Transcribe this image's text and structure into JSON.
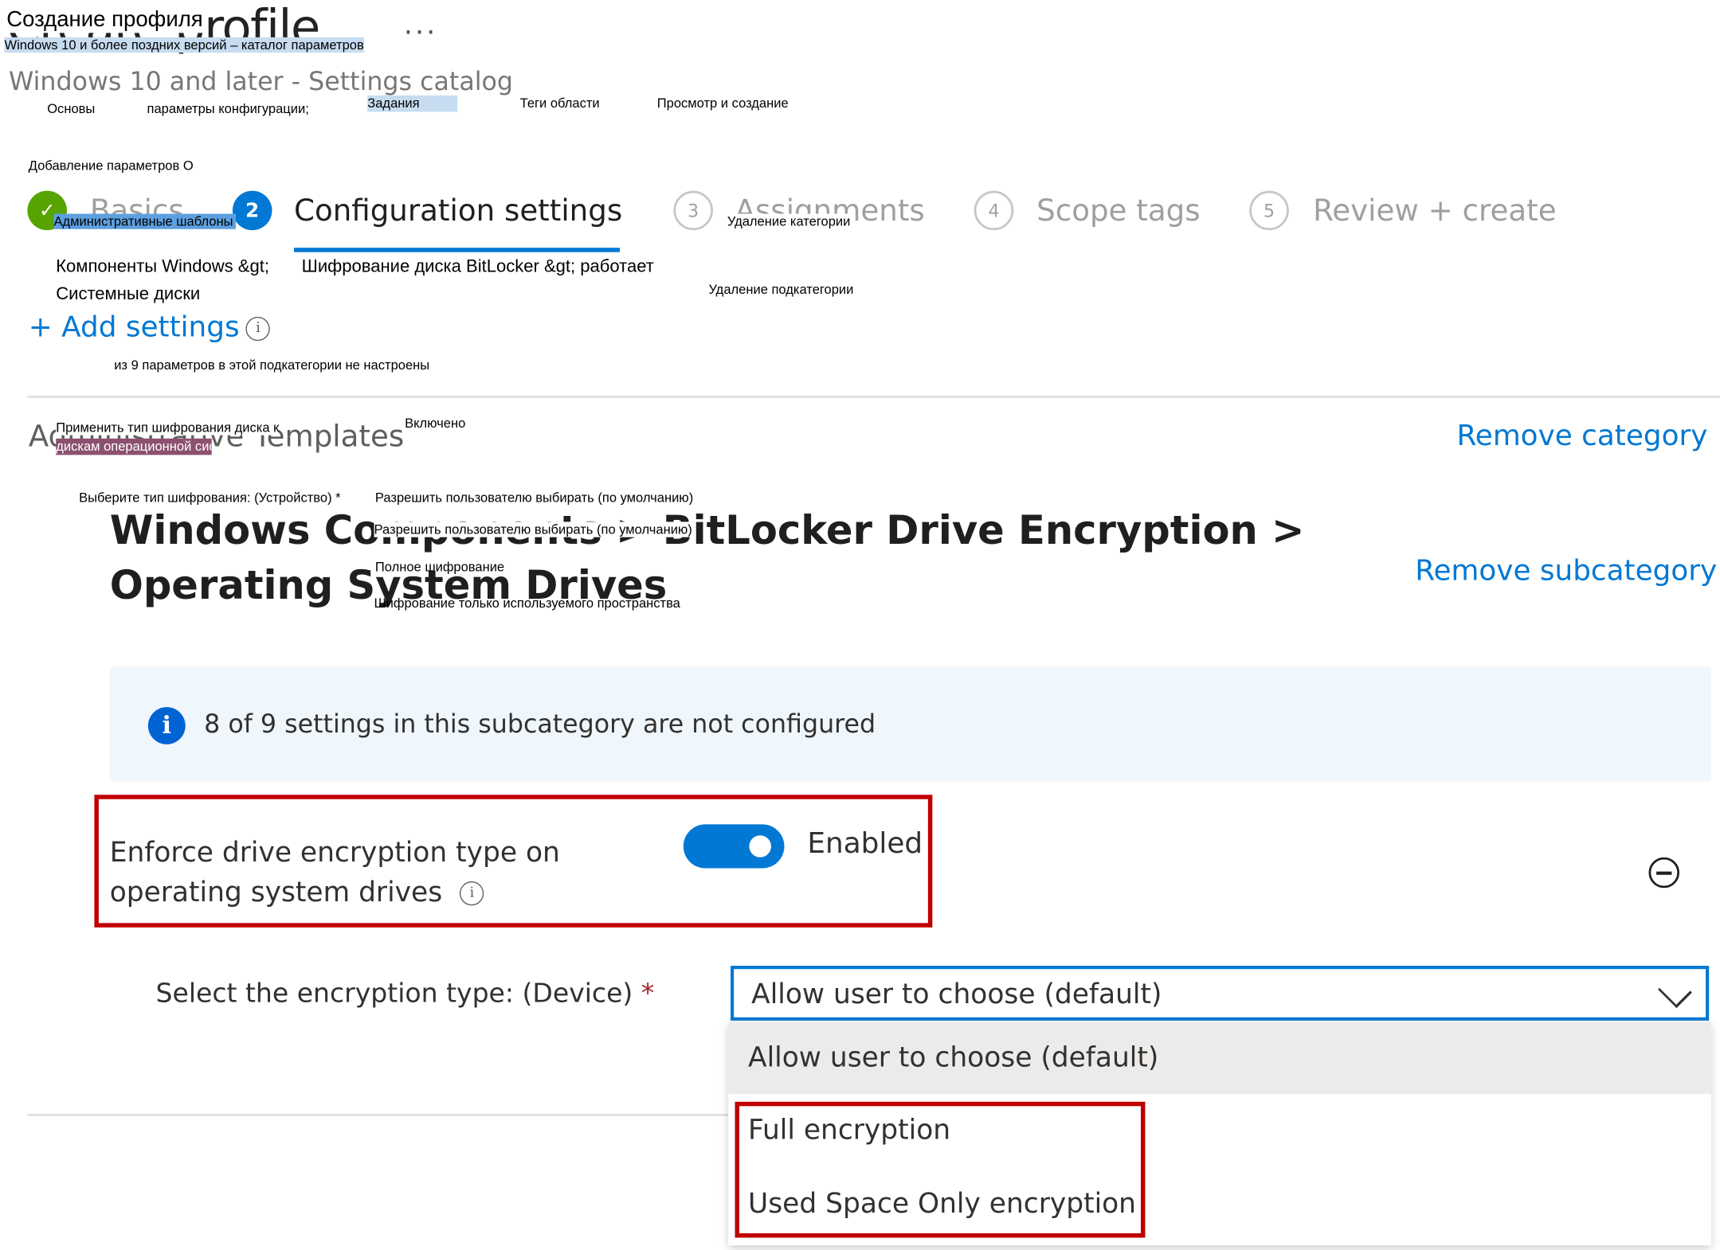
{
  "header": {
    "title": "Create profile",
    "more_icon": "ellipsis-icon",
    "more_label": "...",
    "subtitle": "Windows 10 and later - Settings catalog"
  },
  "stepper": {
    "steps": [
      {
        "number": "1",
        "label": "Basics",
        "state": "completed",
        "icon": "checkmark-icon"
      },
      {
        "number": "2",
        "label": "Configuration settings",
        "state": "active"
      },
      {
        "number": "3",
        "label": "Assignments",
        "state": "pending"
      },
      {
        "number": "4",
        "label": "Scope tags",
        "state": "pending"
      },
      {
        "number": "5",
        "label": "Review + create",
        "state": "pending"
      }
    ],
    "check_glyph": "✓"
  },
  "add_settings": {
    "label": "+ Add settings",
    "info_glyph": "i"
  },
  "category": {
    "title": "Administrative Templates",
    "remove_label": "Remove category"
  },
  "subcategory": {
    "title": "Windows Components > BitLocker Drive Encryption > Operating System Drives",
    "remove_label": "Remove subcategory"
  },
  "info_banner": {
    "icon_glyph": "i",
    "text": "8 of 9 settings in this subcategory are not configured"
  },
  "setting": {
    "name_line1": "Enforce drive encryption type on",
    "name_line2": "operating system drives",
    "info_glyph": "i",
    "toggle_state": "on",
    "toggle_label": "Enabled"
  },
  "encryption_select": {
    "label": "Select the encryption type: (Device)",
    "required_mark": "*",
    "value": "Allow user to choose (default)",
    "options": [
      "Allow user to choose (default)",
      "Full encryption",
      "Used Space Only encryption"
    ],
    "selected_index": 0
  },
  "overlay_ru": {
    "title": "Создание профиля",
    "subtitle": "Windows 10 и более поздних версий – каталог параметров",
    "tab_basics": "Основы",
    "tab_config": "параметры конфигурации;",
    "tab_assignments": "Задания",
    "tab_scope": "Теги области",
    "tab_review": "Просмотр и создание",
    "add_settings": "Добавление параметров О",
    "admin_templates": "Административные шаблоны",
    "remove_category": "Удаление категории",
    "breadcrumb_1": "Компоненты Windows &gt;",
    "breadcrumb_2": "Шифрование диска BitLocker &gt; работает",
    "breadcrumb_3": "Системные диски",
    "remove_subcategory": "Удаление подкатегории",
    "not_configured": "из 9 параметров в этой подкатегории не настроены",
    "setting_name_1": "Применить тип шифрования диска к",
    "setting_name_2": "дискам операционной системы",
    "enabled": "Включено",
    "select_label": "Выберите тип шифрования: (Устройство) *",
    "select_value": "Разрешить пользователю выбирать (по умолчанию)",
    "option_1": "Разрешить пользователю выбирать (по умолчанию)",
    "option_2": "Полное шифрование",
    "option_3": "Шифрование только используемого пространства"
  },
  "colors": {
    "accent": "#0078d4",
    "success": "#57a300",
    "highlight_border": "#c00000",
    "banner_bg": "#eff6fc"
  }
}
